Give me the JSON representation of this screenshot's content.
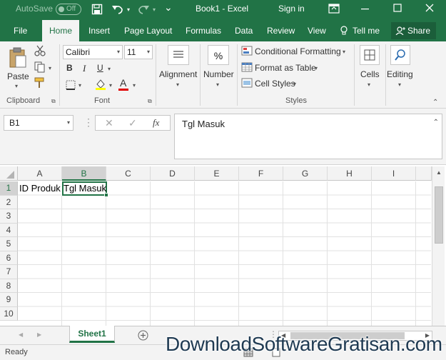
{
  "titlebar": {
    "autosave_label": "AutoSave",
    "autosave_state": "Off",
    "doc_title": "Book1  -  Excel",
    "signin": "Sign in"
  },
  "tabs": [
    {
      "label": "File",
      "active": false
    },
    {
      "label": "Home",
      "active": true
    },
    {
      "label": "Insert",
      "active": false
    },
    {
      "label": "Page Layout",
      "active": false
    },
    {
      "label": "Formulas",
      "active": false
    },
    {
      "label": "Data",
      "active": false
    },
    {
      "label": "Review",
      "active": false
    },
    {
      "label": "View",
      "active": false
    },
    {
      "label": "Tell me",
      "active": false
    }
  ],
  "share_label": "Share",
  "ribbon": {
    "clipboard": {
      "paste": "Paste",
      "group": "Clipboard"
    },
    "font": {
      "name": "Calibri",
      "size": "11",
      "group": "Font",
      "bold": "B",
      "italic": "I",
      "underline": "U",
      "font_color": "A"
    },
    "alignment": "Alignment",
    "number": {
      "label": "Number",
      "symbol": "%"
    },
    "styles": {
      "conditional": "Conditional Formatting",
      "format_table": "Format as Table",
      "cell_styles": "Cell Styles",
      "group": "Styles"
    },
    "cells": "Cells",
    "editing": "Editing"
  },
  "formula_bar": {
    "name_box": "B1",
    "cancel": "✕",
    "enter": "✓",
    "fx": "fx",
    "content": "Tgl Masuk"
  },
  "grid": {
    "columns": [
      "A",
      "B",
      "C",
      "D",
      "E",
      "F",
      "G",
      "H",
      "I"
    ],
    "rows": [
      "1",
      "2",
      "3",
      "4",
      "5",
      "6",
      "7",
      "8",
      "9",
      "10"
    ],
    "selected_cell": "B1",
    "cells": {
      "A1": "ID Produk",
      "B1": "Tgl Masuk"
    }
  },
  "sheet_tab": "Sheet1",
  "status": "Ready",
  "watermark": "DownloadSoftwareGratisan.com",
  "colors": {
    "accent": "#217346"
  }
}
